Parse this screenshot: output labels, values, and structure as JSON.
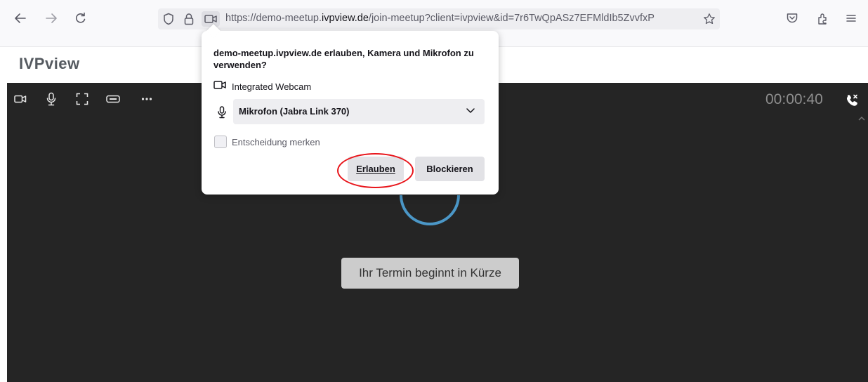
{
  "browser": {
    "url_prefix": "https://demo-meetup.",
    "url_domain": "ivpview.de",
    "url_suffix": "/join-meetup?client=ivpview&id=7r6TwQpASz7EFMldIb5ZvvfxP",
    "icons": [
      "back-icon",
      "forward-icon",
      "reload-icon",
      "shield-icon",
      "lock-icon",
      "camera-permission-icon",
      "bookmark-star-icon",
      "pocket-icon",
      "extensions-icon",
      "menu-icon"
    ]
  },
  "header": {
    "logo": "IVPview"
  },
  "call": {
    "timer": "00:00:40",
    "status": "Ihr Termin beginnt in Kürze",
    "controls": [
      "camera-icon",
      "microphone-icon",
      "fullscreen-icon",
      "connection-icon",
      "more-icon"
    ]
  },
  "popup": {
    "title": "demo-meetup.ivpview.de erlauben, Kamera und Mikrofon zu verwenden?",
    "camera_label": "Integrated Webcam",
    "mic_selected": "Mikrofon (Jabra Link 370)",
    "remember_label": "Entscheidung merken",
    "allow_label": "Erlauben",
    "block_label": "Blockieren"
  },
  "colors": {
    "video_bg": "#252525",
    "spinner": "#4b97c7",
    "highlight": "#e8141a",
    "popup_button_bg": "#e2e2e6"
  }
}
